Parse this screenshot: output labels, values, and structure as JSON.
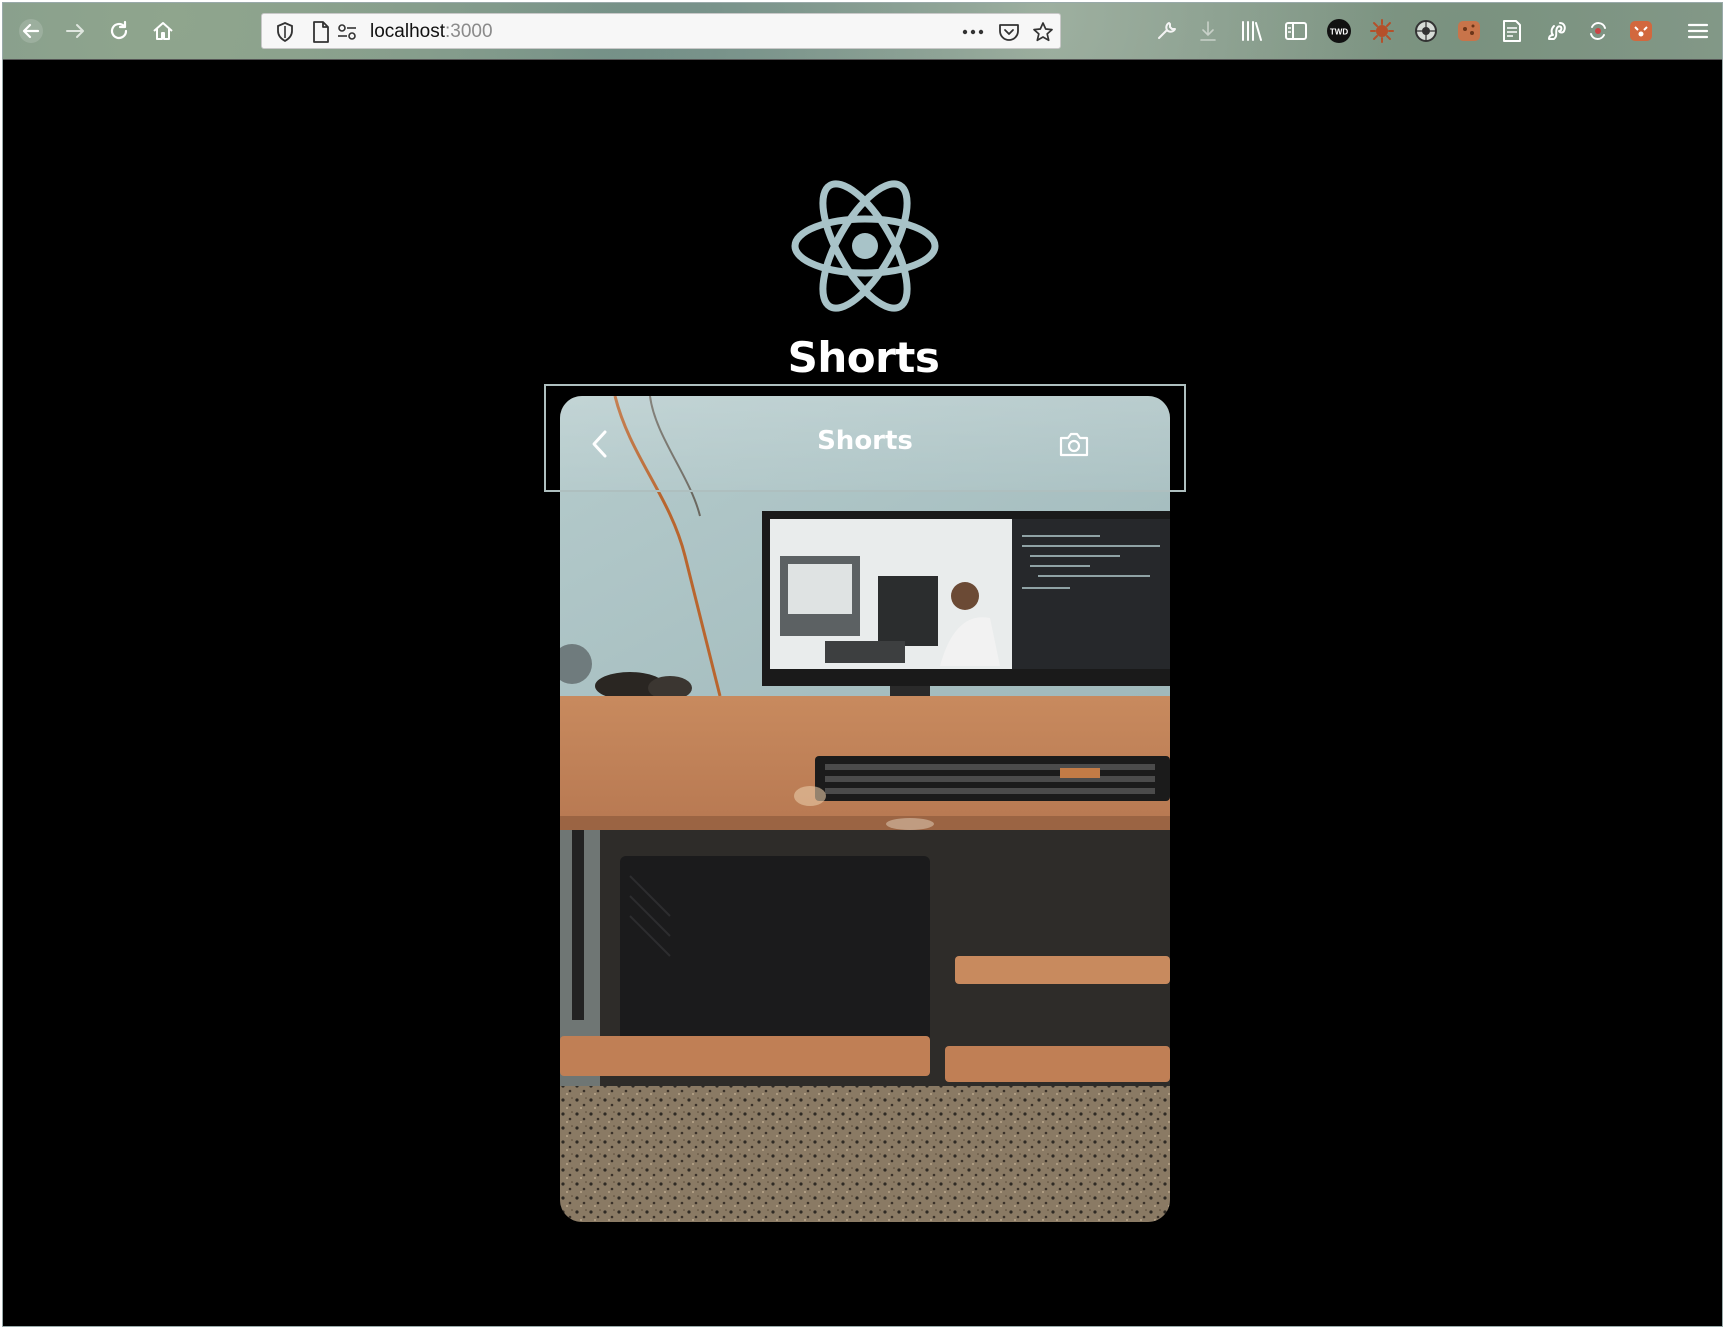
{
  "browser": {
    "url_host": "localhost",
    "url_port": ":3000",
    "toolbar_icons": [
      "back-arrow-icon",
      "forward-arrow-icon",
      "reload-icon",
      "home-icon"
    ],
    "url_icons": [
      "shield-icon",
      "page-icon",
      "permissions-icon"
    ],
    "url_actions": [
      "more-actions-icon",
      "pocket-icon",
      "bookmark-star-icon"
    ],
    "extension_icons": [
      "wrench-icon",
      "download-icon",
      "library-icon",
      "sidebar-icon",
      "twd-extension-icon",
      "virus-extension-icon",
      "globe-extension-icon",
      "cookie-extension-icon",
      "notes-extension-icon",
      "squirrel-extension-icon",
      "sync-extension-icon",
      "fox-extension-icon",
      "hamburger-menu-icon"
    ],
    "twd_label": "TWD"
  },
  "page": {
    "logo": "react-atom-logo",
    "title": "Shorts"
  },
  "player": {
    "header_title": "Shorts",
    "back_icon": "chevron-left-icon",
    "camera_icon": "camera-icon",
    "scene": "desk-with-monitor-video-frame"
  },
  "colors": {
    "page_background": "#000000",
    "logo_color": "#a8c3c8",
    "highlight_border": "#aebfbf",
    "text": "#ffffff"
  }
}
